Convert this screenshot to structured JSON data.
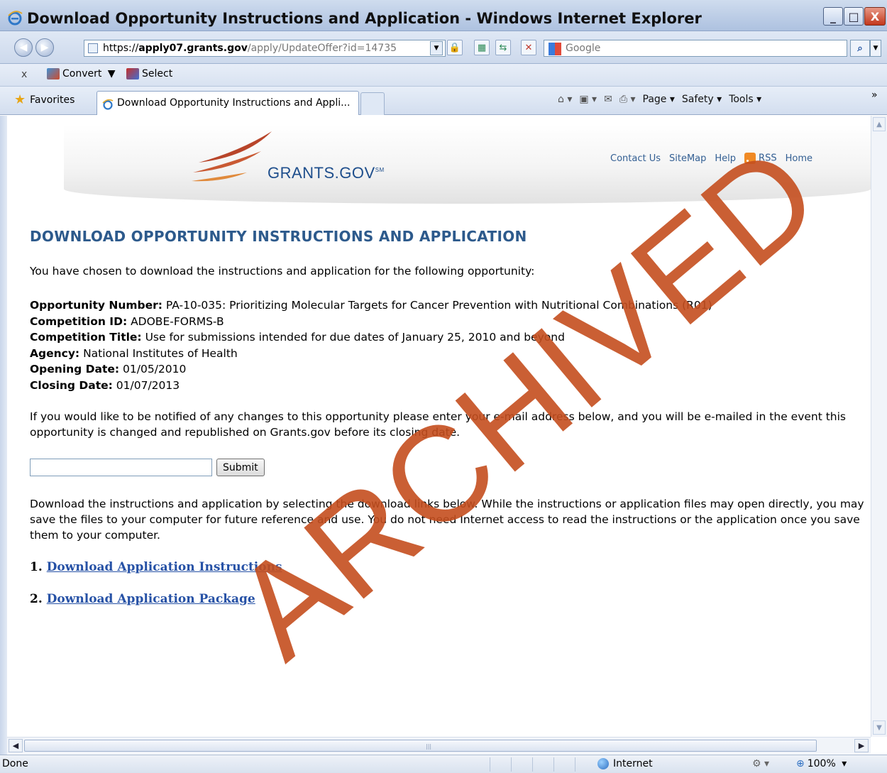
{
  "window": {
    "title": "Download Opportunity Instructions and Application - Windows Internet Explorer",
    "minimize": "_",
    "maximize": "□",
    "close": "X"
  },
  "address": {
    "scheme": "https://",
    "host": "apply07.grants.gov",
    "path": "/apply/UpdateOffer?id=14735",
    "search_placeholder": "Google"
  },
  "command_bar": {
    "close": "x",
    "convert": "Convert",
    "select": "Select"
  },
  "tab_bar": {
    "favorites": "Favorites",
    "active_tab": "Download Opportunity Instructions and Appli...",
    "page": "Page",
    "safety": "Safety",
    "tools": "Tools",
    "chevron": "»"
  },
  "header": {
    "logo_text": "GRANTS.GOV",
    "logo_mark": "SM",
    "links": [
      "Contact Us",
      "SiteMap",
      "Help",
      "RSS",
      "Home"
    ]
  },
  "page": {
    "title": "DOWNLOAD OPPORTUNITY INSTRUCTIONS AND APPLICATION",
    "intro": "You have chosen to download the instructions and application for the following opportunity:",
    "details": [
      {
        "label": "Opportunity Number:",
        "value": " PA-10-035: Prioritizing Molecular Targets for Cancer Prevention with Nutritional Combinations (R01)"
      },
      {
        "label": "Competition ID:",
        "value": " ADOBE-FORMS-B"
      },
      {
        "label": "Competition Title:",
        "value": " Use for submissions intended for due dates of January 25, 2010 and beyond"
      },
      {
        "label": "Agency:",
        "value": " National Institutes of Health"
      },
      {
        "label": "Opening Date:",
        "value": " 01/05/2010"
      },
      {
        "label": "Closing Date:",
        "value": " 01/07/2013"
      }
    ],
    "notify_text": "If you would like to be notified of any changes to this opportunity please enter your e-mail address below, and you will be e-mailed in the event this opportunity is changed and republished on Grants.gov before its closing date.",
    "email_value": "",
    "submit_label": "Submit",
    "download_text": "Download the instructions and application by selecting the download links below. While the instructions or application files may open directly, you may save the files to your computer for future reference and use. You do not need Internet access to read the instructions or the application once you save them to your computer.",
    "downloads": [
      {
        "number": "1.",
        "label": "Download Application Instructions"
      },
      {
        "number": "2.",
        "label": "Download Application Package"
      }
    ],
    "watermark": "ARCHIVED"
  },
  "status": {
    "left": "Done",
    "zone": "Internet",
    "zoom": "100%"
  },
  "colors": {
    "heading": "#2d5a8c",
    "link": "#2752a6",
    "watermark": "#c44e1e",
    "logo": "#1e4e8c"
  }
}
